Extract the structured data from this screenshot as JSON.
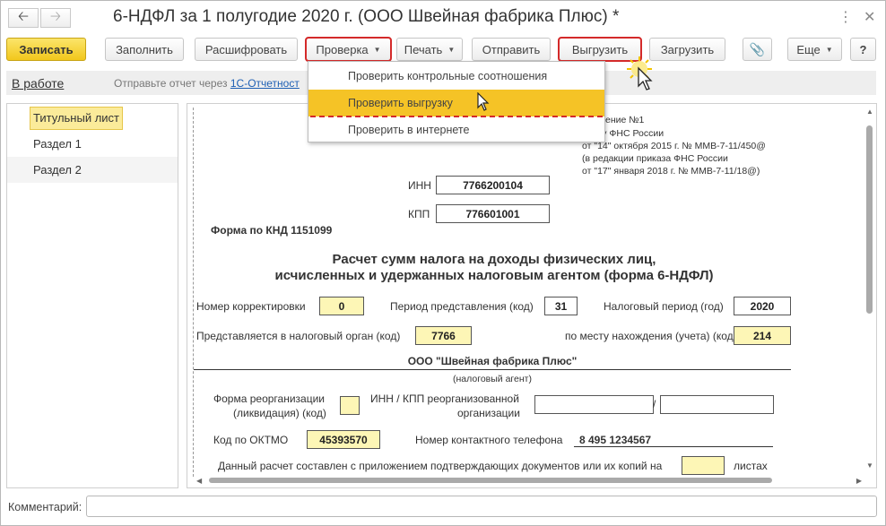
{
  "window": {
    "title": "6-НДФЛ за 1 полугодие 2020 г. (ООО Швейная фабрика Плюс) *",
    "back_icon": "arrow-left-icon",
    "forward_icon": "arrow-right-icon"
  },
  "toolbar": {
    "save": "Записать",
    "fill": "Заполнить",
    "decode": "Расшифровать",
    "check": "Проверка",
    "print": "Печать",
    "send": "Отправить",
    "upload": "Выгрузить",
    "load": "Загрузить",
    "more": "Еще",
    "help": "?"
  },
  "status": {
    "state": "В работе",
    "message": "Отправьте отчет через",
    "link": "1С-Отчетност"
  },
  "dropdown": {
    "items": [
      "Проверить контрольные соотношения",
      "Проверить выгрузку",
      "Проверить в интернете"
    ],
    "highlighted_index": 1
  },
  "sections": [
    "Титульный лист",
    "Раздел 1",
    "Раздел 2"
  ],
  "form": {
    "appendix": [
      "ложение №1",
      "казу ФНС России",
      "от \"14\" октября 2015 г. № ММВ-7-11/450@",
      "(в редакции приказа ФНС России",
      "от \"17\" января 2018 г. № ММВ-7-11/18@)"
    ],
    "inn_label": "ИНН",
    "inn": "7766200104",
    "kpp_label": "КПП",
    "kpp": "776601001",
    "knd": "Форма по КНД 1151099",
    "title_line1": "Расчет сумм налога на доходы физических лиц,",
    "title_line2": "исчисленных и удержанных налоговым агентом (форма 6-НДФЛ)",
    "correction_label": "Номер корректировки",
    "correction": "0",
    "period_code_label": "Период представления (код)",
    "period_code": "31",
    "tax_period_label": "Налоговый период (год)",
    "tax_period": "2020",
    "tax_authority_label": "Представляется в налоговый орган (код)",
    "tax_authority": "7766",
    "location_label": "по месту нахождения (учета) (код)",
    "location": "214",
    "org_name": "ООО \"Швейная фабрика Плюс\"",
    "org_caption": "(налоговый агент)",
    "reorg_label_1": "Форма реорганизации",
    "reorg_label_2": "(ликвидация) (код)",
    "reorg_inn_label_1": "ИНН / КПП реорганизованной",
    "reorg_inn_label_2": "организации",
    "slash": "/",
    "oktmo_label": "Код по ОКТМО",
    "oktmo": "45393570",
    "phone_label": "Номер контактного телефона",
    "phone": "8 495 1234567",
    "attachment_text": "Данный расчет составлен с приложением подтверждающих документов или их копий на",
    "sheets_label": "листах"
  },
  "comment": {
    "label": "Комментарий:",
    "value": ""
  },
  "colors": {
    "primary_button": "#f2c71c",
    "highlight_item": "#f5c326",
    "red_outline": "#d42a2a",
    "editable_field": "#fdf6b6"
  }
}
